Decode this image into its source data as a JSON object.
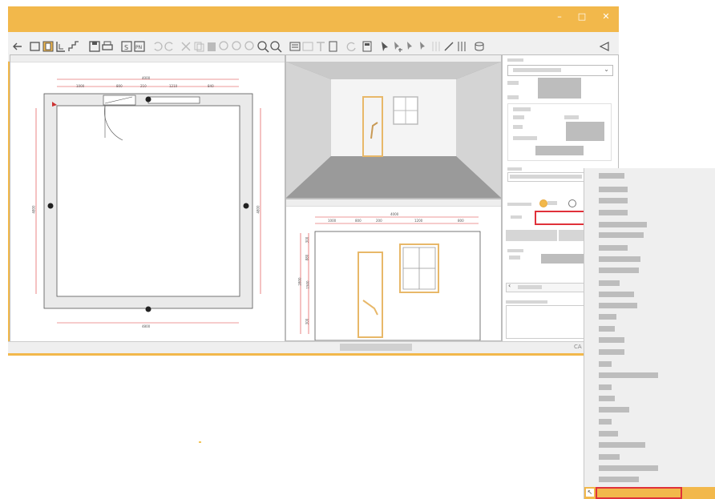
{
  "window": {
    "controls": {
      "minimize": "–",
      "maximize": "□",
      "close": "✕"
    }
  },
  "toolbar": {
    "back_icon": "arrow-left-icon",
    "right_icon": "flag-icon"
  },
  "floorplan": {
    "dims": {
      "top_total": "4000",
      "top_segments": [
        "1000",
        "800",
        "210",
        "1210",
        "840"
      ],
      "left_height": "4800",
      "right_height": "4800",
      "bottom_total": "4800"
    },
    "markers": [
      "❶",
      "❷",
      "❸"
    ]
  },
  "elevation": {
    "dims": {
      "top_total": "4000",
      "top_segments": [
        "1000",
        "800",
        "200",
        "1200",
        "800"
      ],
      "left_segments": [
        "300",
        "880",
        "1500",
        "300"
      ],
      "left_total": "2800"
    }
  },
  "side_panel": {
    "tool_icon": "cursor-plus-icon"
  },
  "status": {
    "right_text": "CA"
  },
  "colors": {
    "accent": "#f2b84b",
    "highlight": "#e0313a",
    "wall": "#eaeaea"
  }
}
